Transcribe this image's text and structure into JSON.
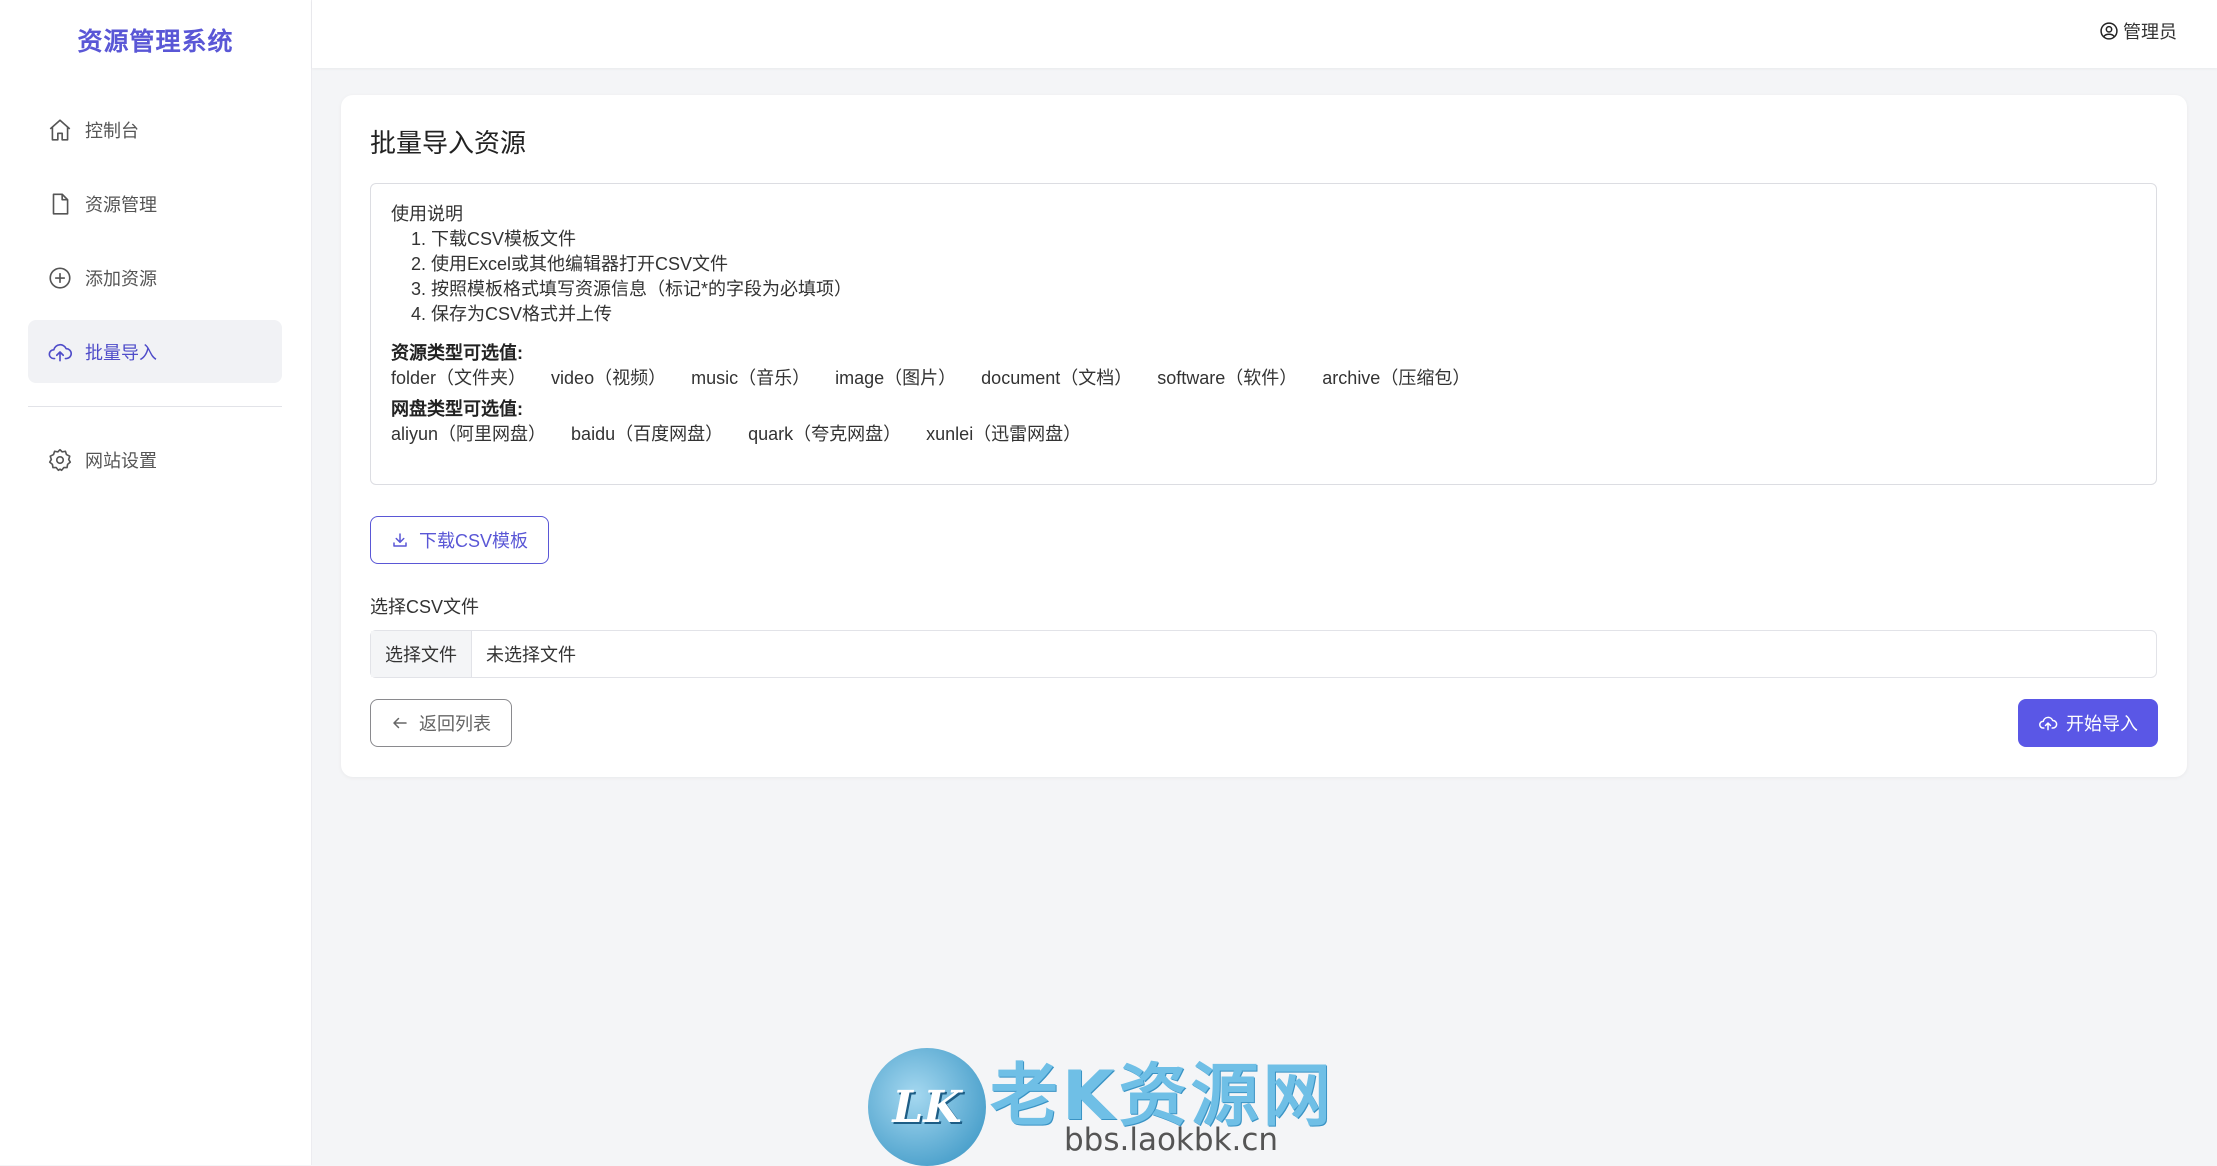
{
  "brand": "资源管理系统",
  "sidebar": {
    "items": [
      {
        "label": "控制台",
        "icon": "home-icon"
      },
      {
        "label": "资源管理",
        "icon": "file-icon"
      },
      {
        "label": "添加资源",
        "icon": "plus-circle-icon"
      },
      {
        "label": "批量导入",
        "icon": "cloud-upload-icon",
        "active": true
      },
      {
        "label": "网站设置",
        "icon": "gear-icon"
      }
    ]
  },
  "header": {
    "user_label": "管理员"
  },
  "main": {
    "title": "批量导入资源",
    "instructions": {
      "heading": "使用说明",
      "steps": [
        "下载CSV模板文件",
        "使用Excel或其他编辑器打开CSV文件",
        "按照模板格式填写资源信息（标记*的字段为必填项）",
        "保存为CSV格式并上传"
      ],
      "resource_types_label": "资源类型可选值:",
      "resource_types": [
        "folder（文件夹）",
        "video（视频）",
        "music（音乐）",
        "image（图片）",
        "document（文档）",
        "software（软件）",
        "archive（压缩包）"
      ],
      "disk_types_label": "网盘类型可选值:",
      "disk_types": [
        "aliyun（阿里网盘）",
        "baidu（百度网盘）",
        "quark（夸克网盘）",
        "xunlei（迅雷网盘）"
      ]
    },
    "download_button": "下载CSV模板",
    "file_field": {
      "label": "选择CSV文件",
      "button": "选择文件",
      "status": "未选择文件"
    },
    "back_button": "返回列表",
    "submit_button": "开始导入"
  },
  "watermark": {
    "logo_text": "LK",
    "title": "老K资源网",
    "url": "bbs.laokbk.cn"
  },
  "colors": {
    "accent": "#5a57e6",
    "brand": "#5a57d6"
  }
}
